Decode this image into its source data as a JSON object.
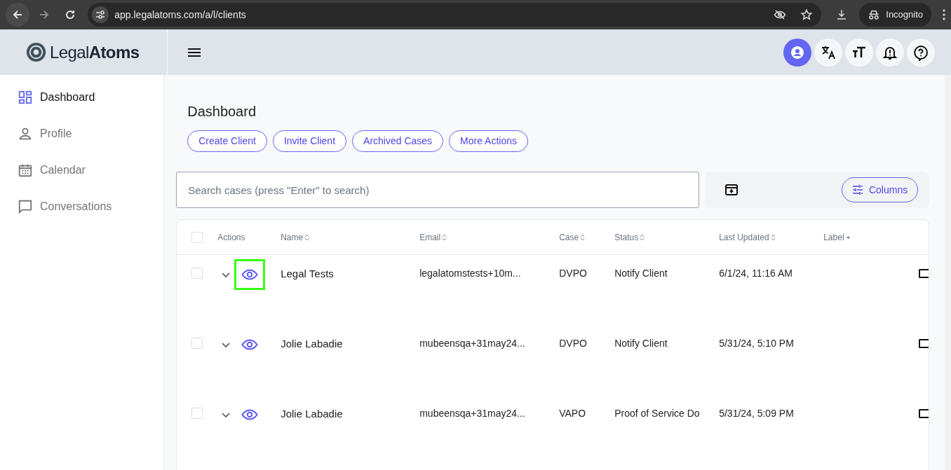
{
  "browser": {
    "url": "app.legalatoms.com/a/l/clients",
    "profile": "Incognito"
  },
  "app": {
    "logo_light": "Legal",
    "logo_bold": "Atoms"
  },
  "header_icons": [
    {
      "kind": "account",
      "selected": true
    },
    {
      "kind": "translate",
      "selected": false
    },
    {
      "kind": "text-size",
      "selected": false
    },
    {
      "kind": "bell",
      "selected": false
    },
    {
      "kind": "help",
      "selected": false
    }
  ],
  "sidebar": {
    "items": [
      {
        "label": "Dashboard",
        "kind": "dashboard",
        "selected": true
      },
      {
        "label": "Profile",
        "kind": "person",
        "selected": false
      },
      {
        "label": "Calendar",
        "kind": "calendar",
        "selected": false
      },
      {
        "label": "Conversations",
        "kind": "chat",
        "selected": false
      }
    ]
  },
  "page_title": "Dashboard",
  "actions": [
    "Create Client",
    "Invite Client",
    "Archived Cases",
    "More Actions"
  ],
  "search": {
    "placeholder": "Search cases (press \"Enter\" to search)"
  },
  "columns_button": "Columns",
  "table": {
    "select_all_checked": false,
    "columns": [
      {
        "label": "Actions",
        "kind": "plain"
      },
      {
        "label": "Name",
        "kind": "sortable"
      },
      {
        "label": "Email",
        "kind": "sortable"
      },
      {
        "label": "Case",
        "kind": "sortable"
      },
      {
        "label": "Status",
        "kind": "sortable"
      },
      {
        "label": "Last Updated",
        "kind": "sortable"
      },
      {
        "label": "Label",
        "kind": "menu"
      }
    ],
    "rows": [
      {
        "checked": false,
        "highlighted": true,
        "name": "Legal Tests",
        "email": "legalatomstests+10m...",
        "case": "DVPO",
        "status": "Notify Client",
        "updated": "6/1/24, 11:16 AM"
      },
      {
        "checked": false,
        "highlighted": false,
        "name": "Jolie Labadie",
        "email": "mubeensqa+31may24...",
        "case": "DVPO",
        "status": "Notify Client",
        "updated": "5/31/24, 5:10 PM"
      },
      {
        "checked": false,
        "highlighted": false,
        "name": "Jolie Labadie",
        "email": "mubeensqa+31may24...",
        "case": "VAPO",
        "status": "Proof of Service Do",
        "updated": "5/31/24, 5:09 PM"
      }
    ]
  }
}
